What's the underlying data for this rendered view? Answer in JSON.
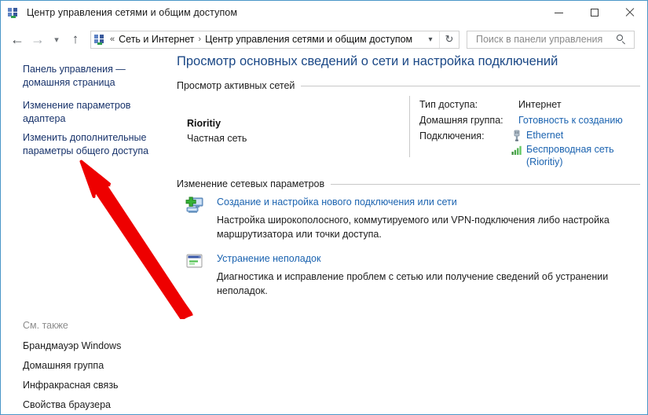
{
  "window": {
    "title": "Центр управления сетями и общим доступом",
    "icon": "network-icon",
    "controls": {
      "minimize": "minimize-icon",
      "maximize": "maximize-icon",
      "close": "close-icon"
    }
  },
  "nav": {
    "back": "back-arrow-icon",
    "forward": "forward-arrow-icon",
    "recent": "recent-locations-chevron-icon",
    "up": "up-arrow-icon",
    "address": {
      "icon": "network-icon",
      "overflow": "«",
      "crumbs": [
        "Сеть и Интернет",
        "Центр управления сетями и общим доступом"
      ],
      "separator": "›",
      "dropdown": "chevron-down-icon",
      "refresh": "refresh-icon"
    },
    "search": {
      "placeholder": "Поиск в панели управления",
      "value": "",
      "icon": "search-icon"
    }
  },
  "sidebar": {
    "links": [
      {
        "label": "Панель управления — домашняя страница"
      },
      {
        "label": "Изменение параметров адаптера"
      },
      {
        "label": "Изменить дополнительные параметры общего доступа"
      }
    ],
    "see_also": {
      "label": "См. также",
      "links": [
        "Брандмауэр Windows",
        "Домашняя группа",
        "Инфракрасная связь",
        "Свойства браузера"
      ]
    }
  },
  "main": {
    "heading": "Просмотр основных сведений о сети и настройка подключений",
    "active_networks": {
      "group_title": "Просмотр активных сетей",
      "network": {
        "name": "Rioritiy",
        "type": "Частная сеть"
      },
      "details": {
        "access_label": "Тип доступа:",
        "access_value": "Интернет",
        "homegroup_label": "Домашняя группа:",
        "homegroup_value": "Готовность к созданию",
        "connections_label": "Подключения:",
        "connections": [
          {
            "name": "Ethernet",
            "icon": "ethernet-plug-icon"
          },
          {
            "name": "Беспроводная сеть (Rioritiy)",
            "icon": "wifi-signal-bars-icon"
          }
        ]
      }
    },
    "change_settings": {
      "group_title": "Изменение сетевых параметров",
      "items": [
        {
          "icon": "new-connection-icon",
          "link": "Создание и настройка нового подключения или сети",
          "description": "Настройка широкополосного, коммутируемого или VPN-подключения либо настройка маршрутизатора или точки доступа."
        },
        {
          "icon": "troubleshoot-icon",
          "link": "Устранение неполадок",
          "description": "Диагностика и исправление проблем с сетью или получение сведений об устранении неполадок."
        }
      ]
    }
  },
  "annotation": {
    "arrow": {
      "name": "red-arrow-annotation",
      "color": "#ee0000",
      "points_to": "Изменить дополнительные параметры общего доступа"
    }
  }
}
